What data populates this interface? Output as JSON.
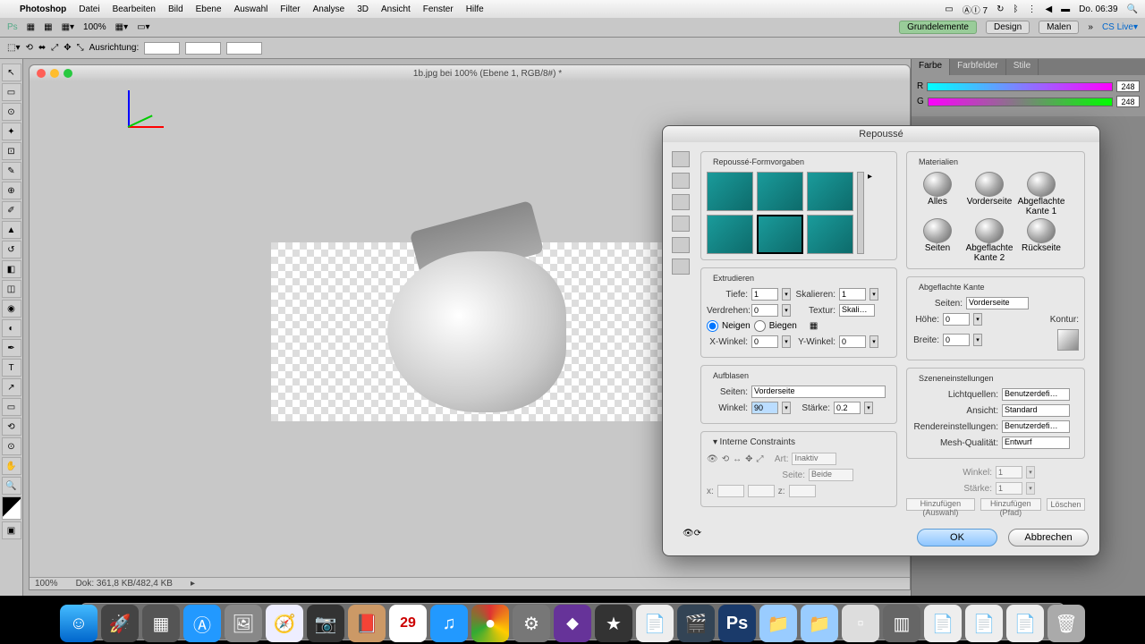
{
  "menubar": {
    "app": "Photoshop",
    "items": [
      "Datei",
      "Bearbeiten",
      "Bild",
      "Ebene",
      "Auswahl",
      "Filter",
      "Analyse",
      "3D",
      "Ansicht",
      "Fenster",
      "Hilfe"
    ],
    "clock": "Do. 06:39",
    "battery": "⚡"
  },
  "optbar": {
    "zoom": "100%",
    "grund": "Grundelemente",
    "design": "Design",
    "malen": "Malen",
    "cs": "CS Live▾"
  },
  "toolbar2": {
    "label": "Ausrichtung:"
  },
  "doc": {
    "title": "1b.jpg bei 100% (Ebene 1, RGB/8#) *",
    "status_zoom": "100%",
    "status_doc": "Dok: 361,8 KB/482,4 KB"
  },
  "panels": {
    "tabs": [
      "Farbe",
      "Farbfelder",
      "Stile"
    ],
    "r": {
      "label": "R",
      "val": "248"
    },
    "g": {
      "label": "G",
      "val": "248"
    }
  },
  "dialog": {
    "title": "Repoussé",
    "presets_title": "Repoussé-Formvorgaben",
    "materials": {
      "title": "Materialien",
      "items": [
        "Alles",
        "Vorderseite",
        "Abgeflachte Kante 1",
        "Seiten",
        "Abgeflachte Kante 2",
        "Rückseite"
      ]
    },
    "extrude": {
      "title": "Extrudieren",
      "tiefe": "Tiefe:",
      "tiefe_v": "1",
      "skalieren": "Skalieren:",
      "skal_v": "1",
      "verdrehen": "Verdrehen:",
      "verd_v": "0",
      "textur": "Textur:",
      "textur_v": "Skali…",
      "neigen": "Neigen",
      "biegen": "Biegen",
      "xwinkel": "X-Winkel:",
      "xw_v": "0",
      "ywinkel": "Y-Winkel:",
      "yw_v": "0"
    },
    "aufblasen": {
      "title": "Aufblasen",
      "seiten": "Seiten:",
      "seiten_v": "Vorderseite",
      "winkel": "Winkel:",
      "winkel_v": "90",
      "staerke": "Stärke:",
      "staerke_v": "0.2"
    },
    "kante": {
      "title": "Abgeflachte Kante",
      "seiten": "Seiten:",
      "seiten_v": "Vorderseite",
      "hoehe": "Höhe:",
      "hoehe_v": "0",
      "breite": "Breite:",
      "breite_v": "0",
      "kontur": "Kontur:"
    },
    "szene": {
      "title": "Szeneneinstellungen",
      "licht": "Lichtquellen:",
      "licht_v": "Benutzerdefi…",
      "ansicht": "Ansicht:",
      "ansicht_v": "Standard",
      "render": "Rendereinstellungen:",
      "render_v": "Benutzerdefi…",
      "mesh": "Mesh-Qualität:",
      "mesh_v": "Entwurf"
    },
    "constraints": {
      "title": "Interne Constraints",
      "art": "Art:",
      "art_v": "Inaktiv",
      "seite": "Seite:",
      "seite_v": "Beide",
      "winkel": "Winkel:",
      "winkel_v": "1",
      "staerke": "Stärke:",
      "staerke_v": "1",
      "x": "x:",
      "z": "z:",
      "hinzu_a": "Hinzufügen (Auswahl)",
      "hinzu_p": "Hinzufügen (Pfad)",
      "loeschen": "Löschen"
    },
    "ok": "OK",
    "cancel": "Abbrechen"
  },
  "dock": {
    "cal": "29"
  }
}
